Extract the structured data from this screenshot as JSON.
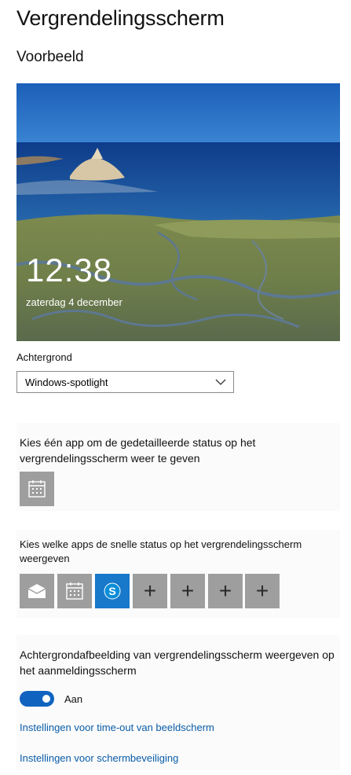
{
  "page": {
    "title": "Vergrendelingsscherm"
  },
  "preview": {
    "heading": "Voorbeeld",
    "time": "12:38",
    "date": "zaterdag 4 december"
  },
  "background": {
    "label": "Achtergrond",
    "selected": "Windows-spotlight"
  },
  "detailed_status": {
    "description": "Kies één app om de gedetailleerde status op het vergrendelingsscherm weer te geven",
    "app_icon": "calendar-icon"
  },
  "quick_status": {
    "description": "Kies welke apps de snelle status op het vergrendelingsscherm weergeven",
    "apps": [
      "mail-icon",
      "calendar-icon",
      "skype-icon",
      "plus-icon",
      "plus-icon",
      "plus-icon",
      "plus-icon"
    ],
    "plus_glyph": "+"
  },
  "signin_background": {
    "description": "Achtergrondafbeelding van vergrendelingsscherm weergeven op het aanmeldingsscherm",
    "toggle_state": "Aan",
    "toggle_on": true
  },
  "links": {
    "timeout": "Instellingen voor time-out van beeldscherm",
    "screensaver": "Instellingen voor schermbeveiliging"
  },
  "colors": {
    "accent": "#1163c0",
    "link": "#0a5ca8",
    "tile": "#9e9e9e",
    "skype": "#0b8ed8"
  }
}
